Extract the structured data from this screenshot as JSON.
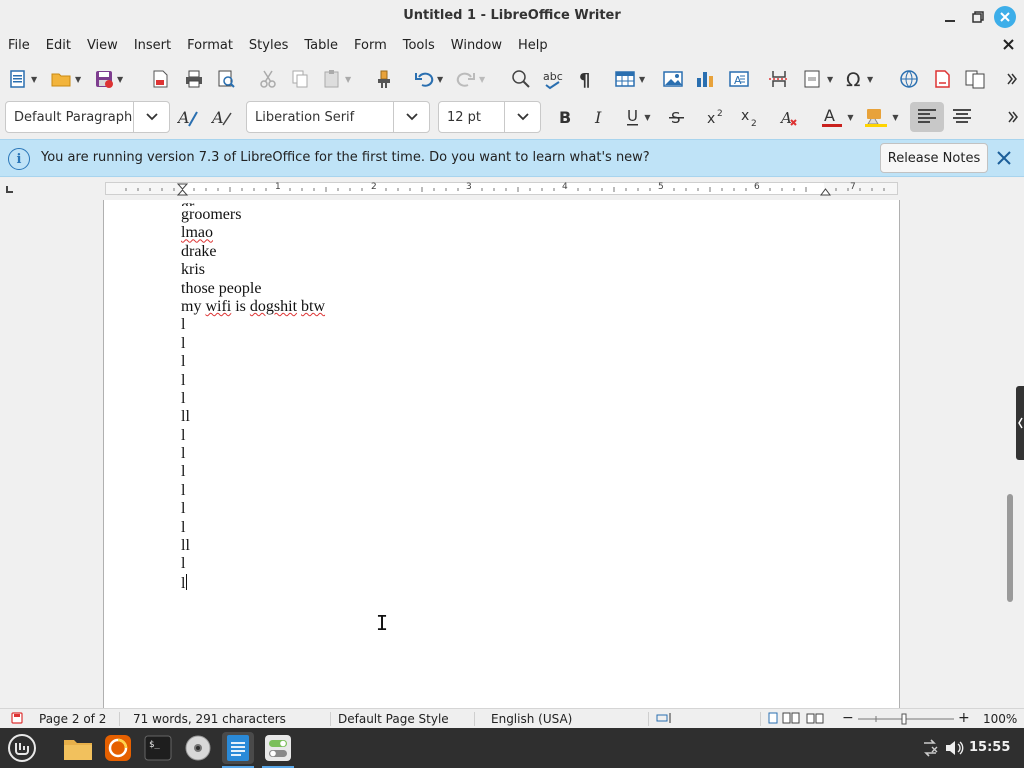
{
  "window": {
    "title": "Untitled 1 - LibreOffice Writer"
  },
  "menu": [
    "File",
    "Edit",
    "View",
    "Insert",
    "Format",
    "Styles",
    "Table",
    "Form",
    "Tools",
    "Window",
    "Help"
  ],
  "formatting": {
    "paragraph_style": "Default Paragraph",
    "font_name": "Liberation Serif",
    "font_size": "12 pt"
  },
  "infobar": {
    "message": "You are running version 7.3 of LibreOffice for the first time. Do you want to learn what's new?",
    "button": "Release Notes"
  },
  "ruler": {
    "numbers": [
      "1",
      "2",
      "3",
      "4",
      "5",
      "6",
      "7"
    ]
  },
  "document": {
    "lines": [
      {
        "text": "groomers",
        "spell": false
      },
      {
        "text": "lmao",
        "spell": true
      },
      {
        "text": "drake",
        "spell": false
      },
      {
        "text": "kris",
        "spell": false
      },
      {
        "text": "those people",
        "spell": false
      },
      {
        "text": "my wifi is dogshit btw",
        "spell": "partial"
      },
      {
        "text": "l",
        "spell": false
      },
      {
        "text": "l",
        "spell": false
      },
      {
        "text": "l",
        "spell": false
      },
      {
        "text": "l",
        "spell": false
      },
      {
        "text": "l",
        "spell": false
      },
      {
        "text": "ll",
        "spell": false
      },
      {
        "text": "l",
        "spell": false
      },
      {
        "text": "l",
        "spell": false
      },
      {
        "text": "l",
        "spell": false
      },
      {
        "text": "l",
        "spell": false
      },
      {
        "text": "l",
        "spell": false
      },
      {
        "text": "l",
        "spell": false
      },
      {
        "text": "ll",
        "spell": false
      },
      {
        "text": "l",
        "spell": false
      },
      {
        "text": "l",
        "spell": false
      }
    ]
  },
  "status": {
    "page": "Page 2 of 2",
    "words": "71 words, 291 characters",
    "page_style": "Default Page Style",
    "language": "English (USA)",
    "zoom": "100%"
  },
  "taskbar": {
    "clock": "15:55"
  },
  "colors": {
    "infobar": "#bfe3f7",
    "accent": "#3daee9",
    "font_color": "#c9211e",
    "highlight": "#ffd400"
  }
}
